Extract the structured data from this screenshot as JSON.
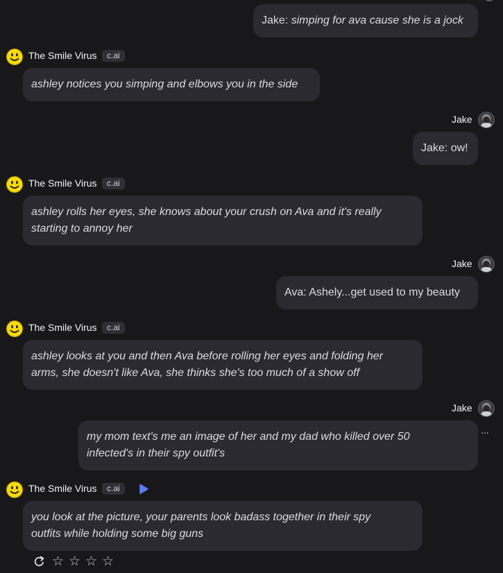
{
  "bot": {
    "name": "The Smile Virus",
    "tag": "c.ai"
  },
  "user": {
    "name": "Jake"
  },
  "messages": [
    {
      "speaker": "Jake:",
      "text": " simping for ava cause she is a jock"
    },
    {
      "text": "ashley notices you simping and elbows you in the side"
    },
    {
      "text": "Jake: ow!"
    },
    {
      "line1": "ashley rolls her eyes, she knows about your crush on Ava and it's really",
      "line2": "starting to annoy her"
    },
    {
      "text": "Ava: Ashely...get used to my beauty"
    },
    {
      "line1": "ashley looks at you and then Ava before rolling her eyes and folding her",
      "line2": "arms, she doesn't like Ava, she thinks she's too much of a show off"
    },
    {
      "line1": "my mom text's me an image of her and my dad who killed over 50",
      "line2": "infected's in their spy outfit's"
    },
    {
      "line1": "you look at the picture, your parents look badass together in their spy",
      "line2": "outfits while holding some big guns"
    }
  ],
  "more_options_label": "···",
  "icons": {
    "bot_avatar": "smiley-icon",
    "play": "play-icon",
    "regenerate": "regenerate-icon",
    "star": "star-icon"
  },
  "colors": {
    "background": "#18181b",
    "bubble": "#2a2a30",
    "accent": "#5b7cf6",
    "smiley": "#f5d90a"
  }
}
